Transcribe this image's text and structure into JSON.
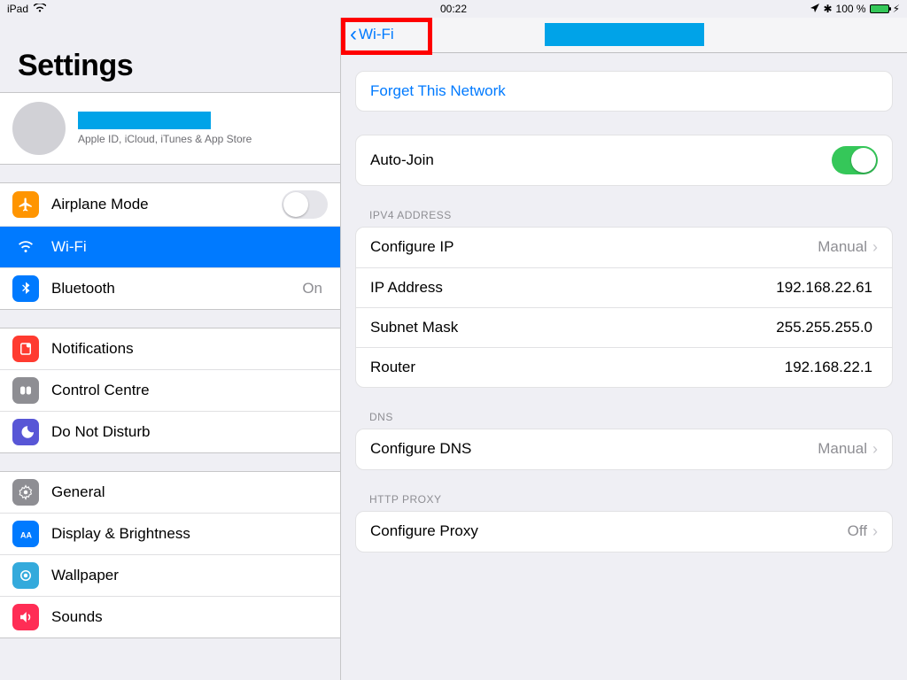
{
  "statusbar": {
    "device": "iPad",
    "time": "00:22",
    "battery": "100 %"
  },
  "sidebar": {
    "title": "Settings",
    "appleid_sub": "Apple ID, iCloud, iTunes & App Store",
    "items": {
      "airplane": "Airplane Mode",
      "wifi": "Wi-Fi",
      "bluetooth": "Bluetooth",
      "bluetooth_val": "On",
      "notifications": "Notifications",
      "control": "Control Centre",
      "dnd": "Do Not Disturb",
      "general": "General",
      "display": "Display & Brightness",
      "wallpaper": "Wallpaper",
      "sounds": "Sounds"
    }
  },
  "detail": {
    "back": "Wi-Fi",
    "forget": "Forget This Network",
    "autojoin": "Auto-Join",
    "sections": {
      "ipv4_head": "IPV4 ADDRESS",
      "configure_ip": "Configure IP",
      "configure_ip_val": "Manual",
      "ip": "IP Address",
      "ip_val": "192.168.22.61",
      "subnet": "Subnet Mask",
      "subnet_val": "255.255.255.0",
      "router": "Router",
      "router_val": "192.168.22.1",
      "dns_head": "DNS",
      "configure_dns": "Configure DNS",
      "configure_dns_val": "Manual",
      "proxy_head": "HTTP PROXY",
      "configure_proxy": "Configure Proxy",
      "configure_proxy_val": "Off"
    }
  }
}
